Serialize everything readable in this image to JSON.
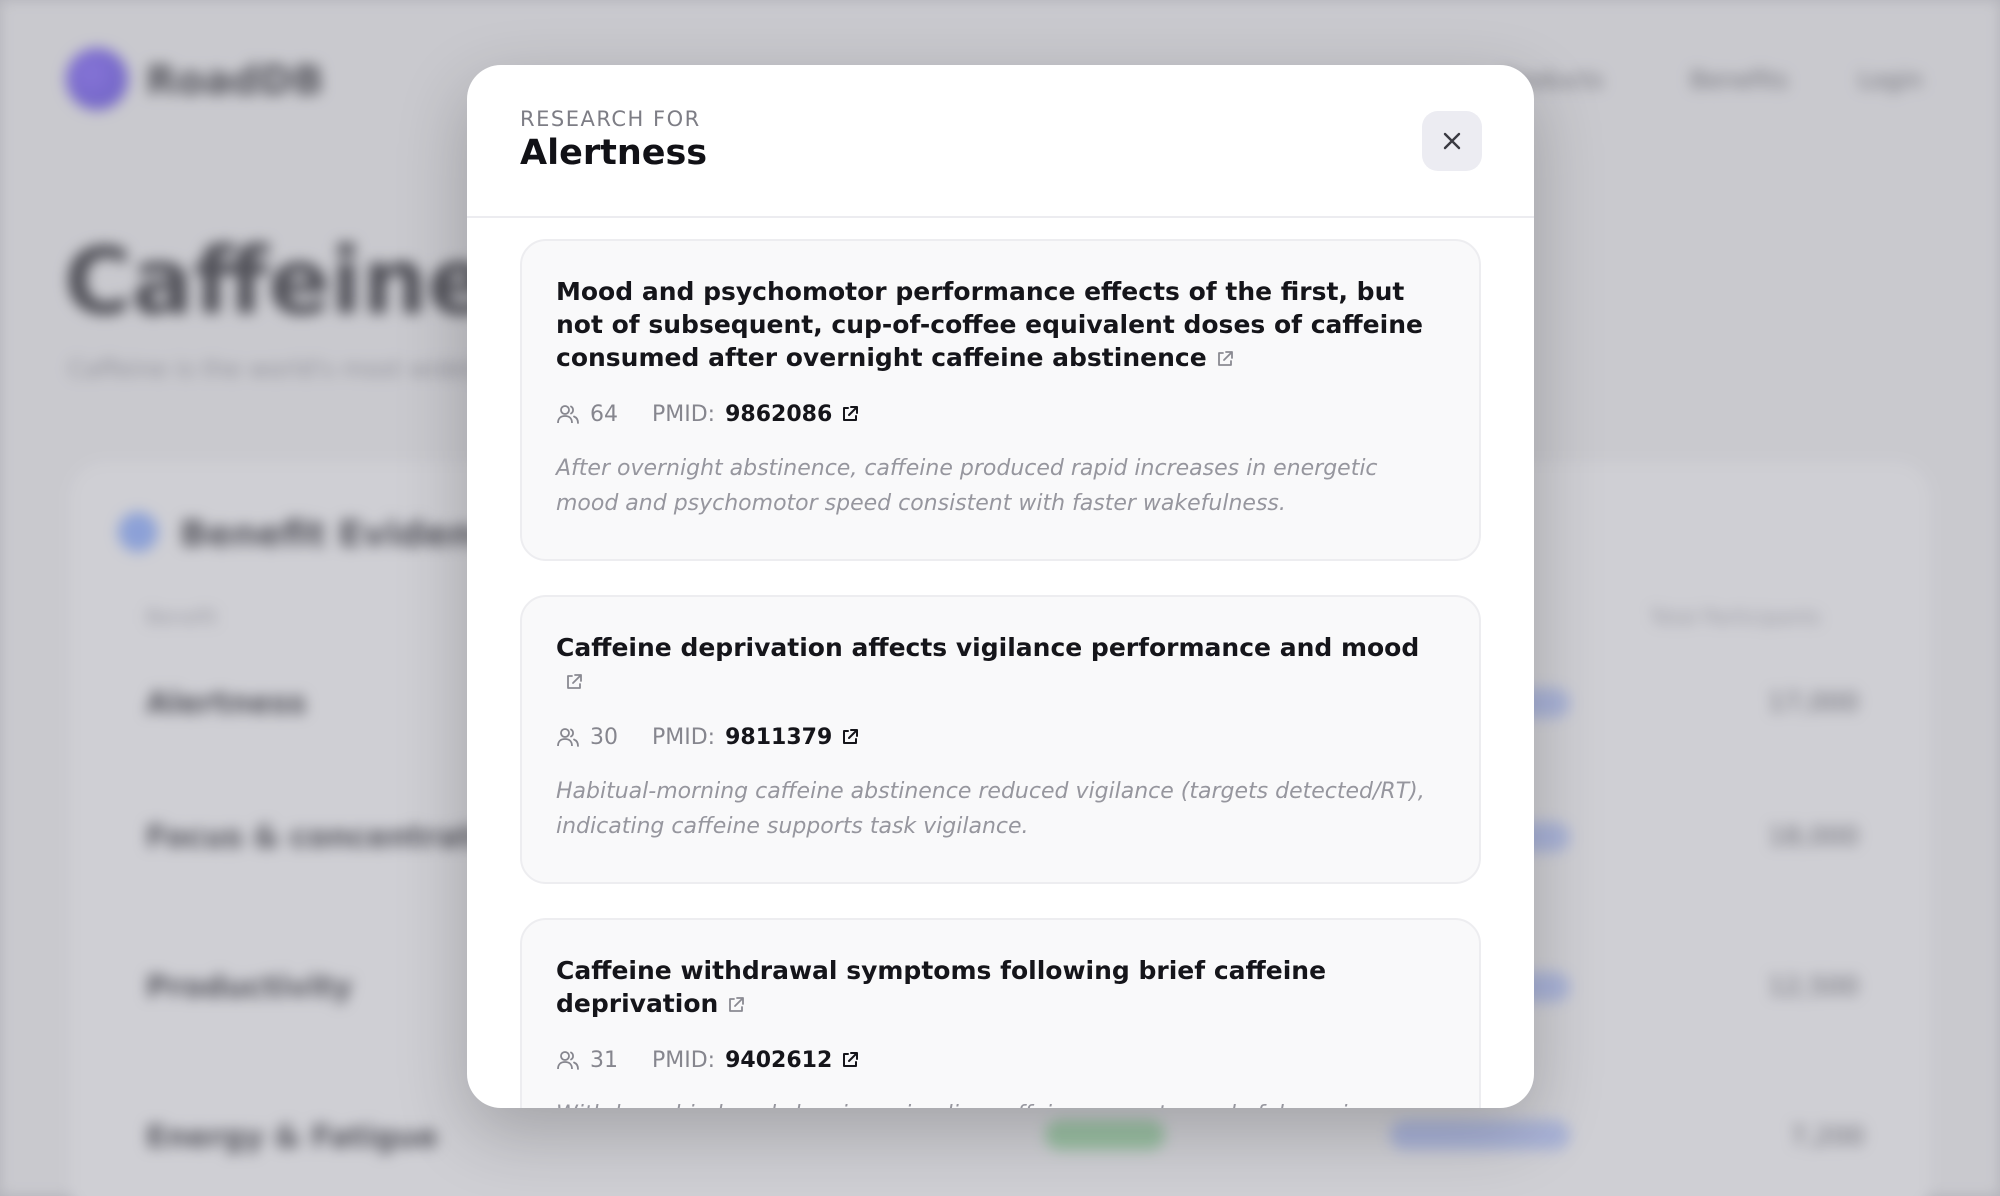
{
  "background": {
    "brand": "RoadDB",
    "nav": [
      "Products",
      "Benefits",
      "Login"
    ],
    "title": "Caffeine",
    "subtitle": "Caffeine is the world's most widely consumed psychoactive substance",
    "card_title": "Benefit Evidence",
    "table_headers": [
      "Benefit",
      "Total Participants"
    ],
    "rows": [
      {
        "name": "Alertness",
        "value": "17,000"
      },
      {
        "name": "Focus & concentration",
        "value": "18,000"
      },
      {
        "name": "Productivity",
        "value": "12,500"
      },
      {
        "name": "Energy & Fatigue",
        "value": "7,200"
      }
    ]
  },
  "modal": {
    "eyebrow": "RESEARCH FOR",
    "title": "Alertness",
    "close_icon": "close-icon",
    "pmid_label": "PMID:",
    "studies": [
      {
        "title": "Mood and psychomotor performance effects of the first, but not of subsequent, cup-of-coffee equivalent doses of caffeine consumed after overnight caffeine abstinence",
        "participants": "64",
        "pmid": "9862086",
        "summary": "After overnight abstinence, caffeine produced rapid increases in energetic mood and psychomotor speed consistent with faster wakefulness."
      },
      {
        "title": "Caffeine deprivation affects vigilance performance and mood",
        "participants": "30",
        "pmid": "9811379",
        "summary": "Habitual-morning caffeine abstinence reduced vigilance (targets detected/RT), indicating caffeine supports task vigilance."
      },
      {
        "title": "Caffeine withdrawal symptoms following brief caffeine deprivation",
        "participants": "31",
        "pmid": "9402612",
        "summary": "Withdrawal-induced sleepiness implies caffeine promotes wakefulness in regular users."
      }
    ]
  }
}
